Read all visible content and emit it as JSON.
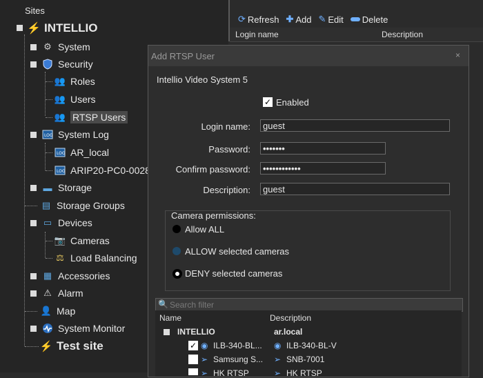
{
  "sites": {
    "header": "Sites",
    "root": "INTELLIO",
    "items": [
      {
        "label": "System"
      },
      {
        "label": "Security"
      },
      {
        "label": "Roles"
      },
      {
        "label": "Users"
      },
      {
        "label": "RTSP Users"
      },
      {
        "label": "System Log"
      },
      {
        "label": "AR_local"
      },
      {
        "label": "ARIP20-PC0-0028"
      },
      {
        "label": "Storage"
      },
      {
        "label": "Storage Groups"
      },
      {
        "label": "Devices"
      },
      {
        "label": "Cameras"
      },
      {
        "label": "Load Balancing"
      },
      {
        "label": "Accessories"
      },
      {
        "label": "Alarm"
      },
      {
        "label": "Map"
      },
      {
        "label": "System Monitor"
      },
      {
        "label": "Test site"
      }
    ]
  },
  "toolbar": {
    "refresh": "Refresh",
    "add": "Add",
    "edit": "Edit",
    "delete": "Delete"
  },
  "grid": {
    "col_login": "Login name",
    "col_desc": "Description"
  },
  "dialog": {
    "title": "Add RTSP User",
    "close": "×",
    "system": "Intellio Video System 5",
    "enabled_label": "Enabled",
    "enabled_checked": "✓",
    "login_label": "Login name:",
    "login_value": "guest",
    "password_label": "Password:",
    "password_value": "•••••••",
    "confirm_label": "Confirm password:",
    "confirm_value": "••••••••••••",
    "desc_label": "Description:",
    "desc_value": "guest",
    "perm_title": "Camera permissions:",
    "perm_all": "Allow ALL",
    "perm_allow": "ALLOW selected cameras",
    "perm_deny": "DENY selected cameras",
    "search_placeholder": "Search filter",
    "table": {
      "col_name": "Name",
      "col_desc": "Description",
      "group_name": "INTELLIO",
      "group_desc": "ar.local",
      "rows": [
        {
          "name": "ILB-340-BL...",
          "desc": "ILB-340-BL-V",
          "checked": "✓"
        },
        {
          "name": "Samsung S...",
          "desc": "SNB-7001",
          "checked": ""
        },
        {
          "name": "HK RTSP",
          "desc": "HK RTSP",
          "checked": ""
        }
      ]
    }
  }
}
